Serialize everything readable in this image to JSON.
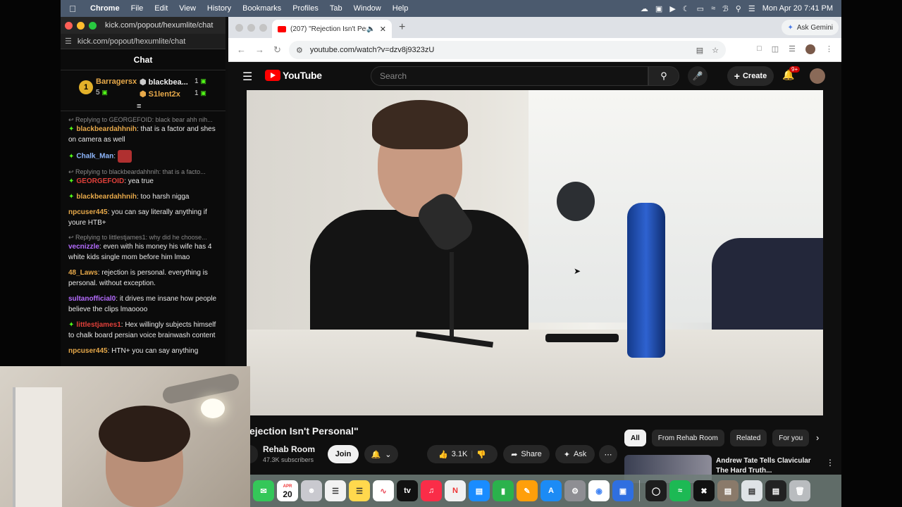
{
  "menubar": {
    "app": "Chrome",
    "items": [
      "File",
      "Edit",
      "View",
      "History",
      "Bookmarks",
      "Profiles",
      "Tab",
      "Window",
      "Help"
    ],
    "datetime": "Mon Apr 20  7:41 PM"
  },
  "chat_window": {
    "title": "kick.com/popout/hexumlite/chat",
    "url": "kick.com/popout/hexumlite/chat",
    "header": "Chat",
    "leaderboard": {
      "rank": "1",
      "first_name": "Barragersx",
      "first_count": "5",
      "second_name": "blackbea...",
      "second_count": "1",
      "third_name": "S1lent2x",
      "third_count": "1"
    },
    "messages": [
      {
        "reply": "Replying to GEORGEFOID: black bear ahh nih...",
        "user": "blackbeardahhnih",
        "text": "that is a factor and shes on camera as well"
      },
      {
        "reply": "",
        "user": "Chalk_Man",
        "text": ""
      },
      {
        "reply": "Replying to blackbeardahhnih: that is a facto...",
        "user": "GEORGEFOID",
        "text": "yea true"
      },
      {
        "reply": "",
        "user": "blackbeardahhnih",
        "text": "too harsh nigga"
      },
      {
        "reply": "",
        "user": "npcuser445",
        "text": "you can say literally anything if youre HTB+"
      },
      {
        "reply": "Replying to littlestjames1: why did he choose...",
        "user": "vecnizzle",
        "text": "even with his money his wife has 4 white kids single mom before him lmao"
      },
      {
        "reply": "",
        "user": "48_Laws",
        "text": "rejection is personal. everything is personal. without exception."
      },
      {
        "reply": "",
        "user": "sultanofficial0",
        "text": "it drives me insane how people believe the clips lmaoooo"
      },
      {
        "reply": "",
        "user": "littlestjames1",
        "text": "Hex willingly subjects himself to chalk board persian voice brainwash content"
      },
      {
        "reply": "",
        "user": "npcuser445",
        "text": "HTN+ you can say anything"
      }
    ]
  },
  "browser": {
    "tab_title": "(207) \"Rejection Isn't Per",
    "new_tab": "+",
    "gemini": "Ask Gemini",
    "url": "youtube.com/watch?v=dzv8j9323zU"
  },
  "youtube": {
    "logo": "YouTube",
    "search_placeholder": "Search",
    "create": "Create",
    "notif_count": "9+",
    "video_title": "ejection Isn't Personal\"",
    "channel_name": "Rehab Room",
    "subscribers": "47.3K subscribers",
    "join": "Join",
    "likes": "3.1K",
    "share": "Share",
    "ask": "Ask",
    "chips": [
      "All",
      "From Rehab Room",
      "Related",
      "For you"
    ],
    "rec_title": "Andrew Tate Tells Clavicular The Hard Truth..."
  },
  "dock": {
    "calendar_month": "APR",
    "calendar_day": "20"
  },
  "colors": {
    "menubar": "#4b5a6e",
    "kick_green": "#53fc18",
    "youtube_red": "#ff0000",
    "yt_dark": "#0f0f0f"
  }
}
